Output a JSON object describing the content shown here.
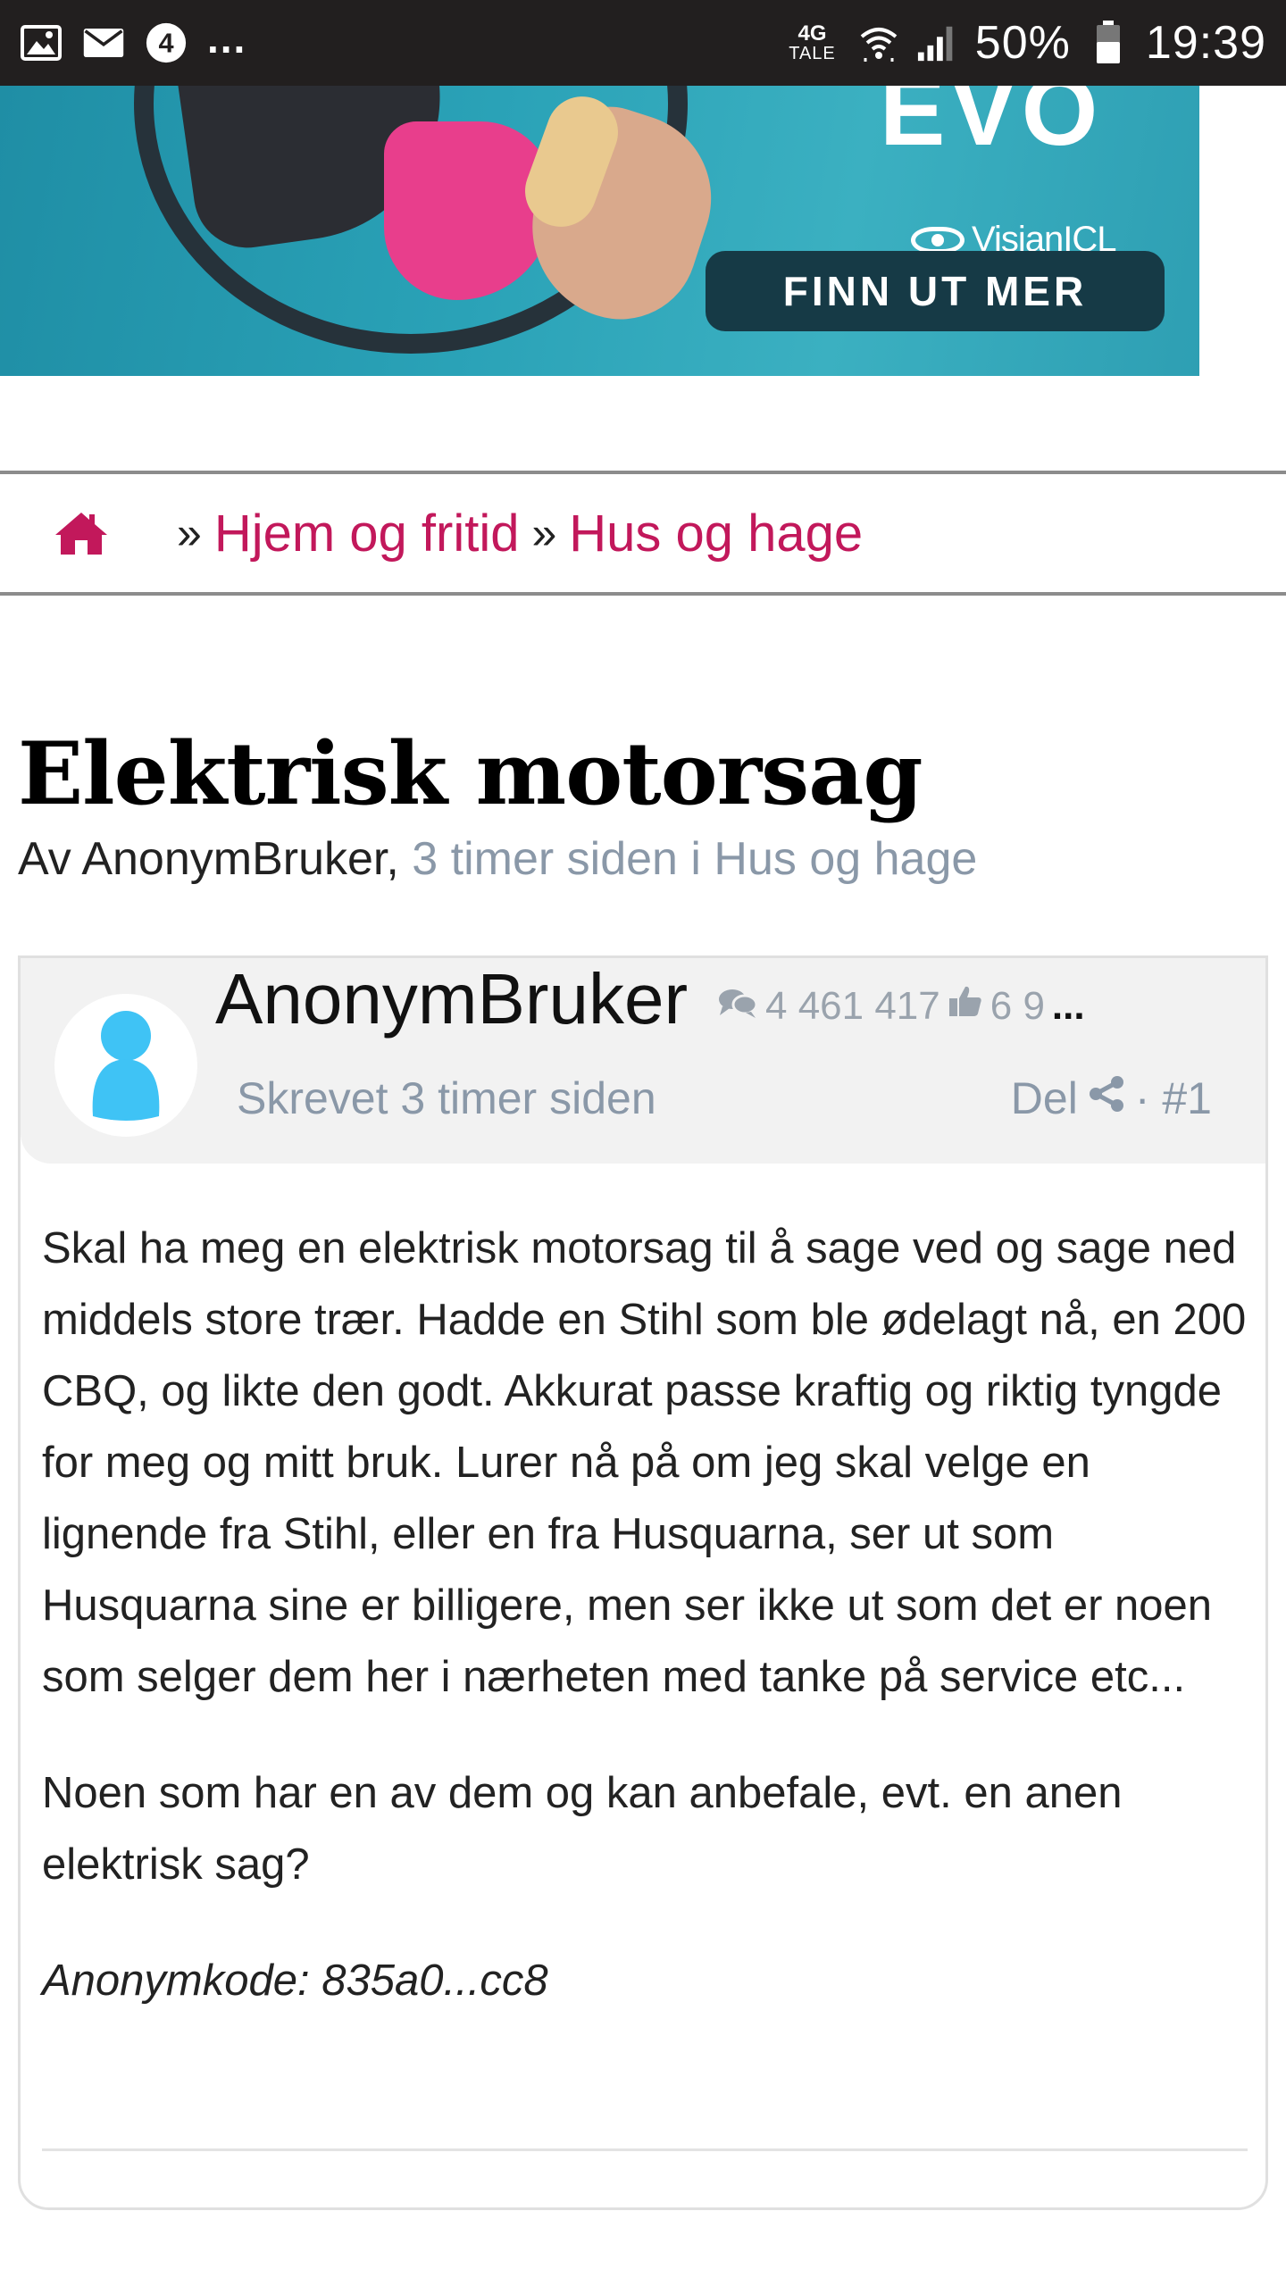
{
  "status_bar": {
    "icons": [
      "image-icon",
      "mail-icon",
      "number-badge-icon"
    ],
    "badge_number": "4",
    "overflow": "...",
    "network_top": "4G",
    "network_bottom": "TALE",
    "battery": "50%",
    "time": "19:39"
  },
  "ad": {
    "headline": "EVO",
    "brand": "VisianICL",
    "cta": "FINN UT MER",
    "colors": {
      "background": "#2aa2b7",
      "cta": "#163a46",
      "accent": "#e83e8c"
    }
  },
  "breadcrumb": {
    "home_icon": "home-icon",
    "separator": "»",
    "items": [
      "Hjem og fritid",
      "Hus og hage"
    ]
  },
  "thread": {
    "title": "Elektrisk motorsag",
    "byline_prefix": "Av AnonymBruker,",
    "byline_meta": "3 timer siden i Hus og hage"
  },
  "post": {
    "author": "AnonymBruker",
    "post_count": "4 461 417",
    "likes": "6 9",
    "likes_overflow": "...",
    "written": "Skrevet 3 timer siden",
    "share_label": "Del",
    "post_number": "· #1",
    "paragraphs": [
      "Skal ha meg en elektrisk motorsag til å sage ved og sage ned middels store trær. Hadde en Stihl som ble ødelagt nå, en 200 CBQ, og likte den godt. Akkurat passe kraftig og riktig tyngde for meg og mitt bruk. Lurer nå på om jeg skal velge en lignende fra Stihl, eller en fra Husquarna, ser ut som Husquarna sine er billigere, men ser ikke ut som det er noen som selger dem her i nærheten med tanke på service etc...",
      "Noen som har en av dem og kan anbefale, evt. en anen elektrisk sag?"
    ],
    "anon_code": "Anonymkode: 835a0...cc8"
  },
  "colors": {
    "link": "#c2185b",
    "muted": "#8a98a8",
    "avatar": "#3fc3f5"
  }
}
